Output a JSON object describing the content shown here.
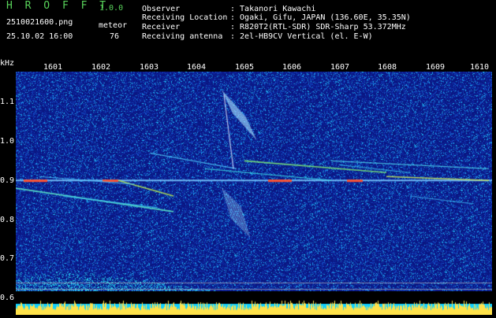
{
  "app": {
    "name": "H R O F F T",
    "version": "1.0.0",
    "filename": "2510021600.png",
    "datetime": "25.10.02 16:00",
    "counter_label": "meteor",
    "counter_value": "76"
  },
  "info": [
    {
      "label": "Observer",
      "value": ": Takanori Kawachi"
    },
    {
      "label": "Receiving Location",
      "value": ": Ogaki, Gifu, JAPAN (136.60E, 35.35N)"
    },
    {
      "label": "Receiver",
      "value": ": R820T2(RTL-SDR) SDR-Sharp 53.372MHz"
    },
    {
      "label": "Receiving antenna",
      "value": ": 2el-HB9CV Vertical (el. E-W)"
    }
  ],
  "axis": {
    "unit": "kHz",
    "y_ticks": [
      "1.1",
      "1.0",
      "0.9",
      "0.8",
      "0.7",
      "0.6"
    ],
    "x_ticks": [
      "1601",
      "1602",
      "1603",
      "1604",
      "1605",
      "1606",
      "1607",
      "1608",
      "1609",
      "1610"
    ]
  },
  "colors": {
    "background": "#0a1a8a",
    "noise_cyan": "#20c8ff",
    "echo_yellow": "#ffd84a",
    "baseline_red": "#ff3c1e",
    "header_green": "#58d25a"
  }
}
